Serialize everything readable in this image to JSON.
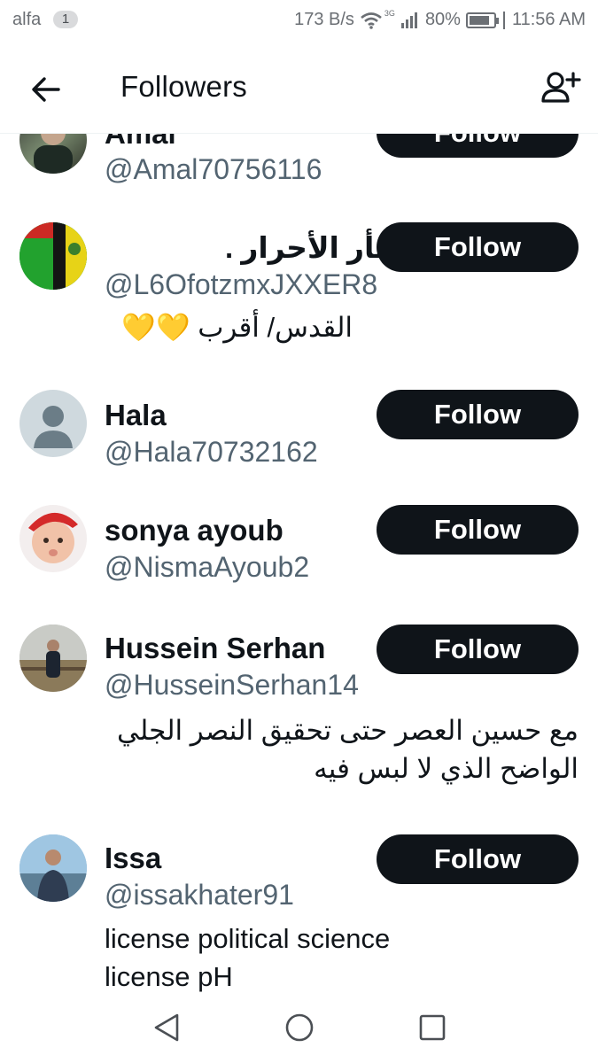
{
  "status_bar": {
    "carrier": "alfa",
    "sim_badge": "1",
    "net_speed": "173 B/s",
    "network_type": "3G",
    "battery": "80%",
    "time": "11:56 AM"
  },
  "header": {
    "title": "Followers",
    "back_icon": "arrow-left-icon",
    "add_icon": "add-user-icon"
  },
  "followers": [
    {
      "name": "Amal",
      "handle": "@Amal70756116",
      "bio": "",
      "button": "Follow"
    },
    {
      "name": "ثأر الأحرار .",
      "handle": "@L6OfotzmxJXXER8",
      "bio": "القدس/ أقرب 💛💛",
      "button": "Follow"
    },
    {
      "name": "Hala",
      "handle": "@Hala70732162",
      "bio": "",
      "button": "Follow"
    },
    {
      "name": "sonya ayoub",
      "handle": "@NismaAyoub2",
      "bio": "",
      "button": "Follow"
    },
    {
      "name": "Hussein Serhan",
      "handle": "@HusseinSerhan14",
      "bio": "مع حسين العصر حتى تحقيق النصر الجلي الواضح الذي لا لبس فيه",
      "button": "Follow"
    },
    {
      "name": "Issa",
      "handle": "@issakhater91",
      "bio": "license political science license pH",
      "button": "Follow"
    }
  ],
  "nav": {
    "back": "triangle-back-icon",
    "home": "circle-home-icon",
    "recents": "square-recents-icon"
  },
  "colors": {
    "button_bg": "#0f1419",
    "handle": "#536471",
    "text": "#0f1419"
  }
}
